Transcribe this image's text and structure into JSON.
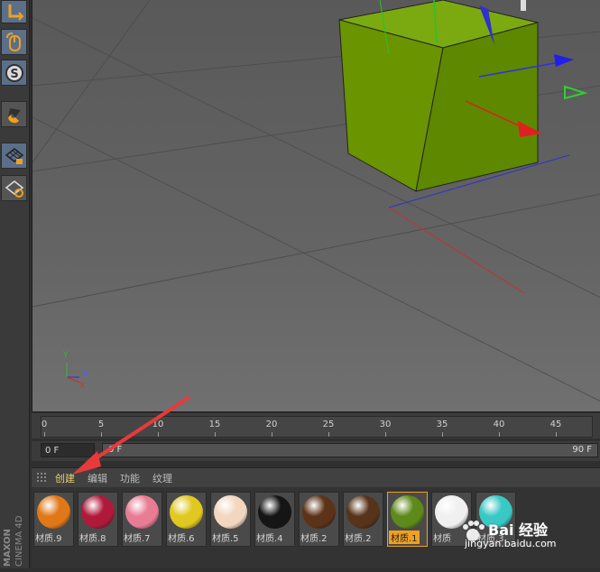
{
  "timeline": {
    "ticks": [
      "0",
      "5",
      "10",
      "15",
      "20",
      "25",
      "30",
      "35",
      "40",
      "45"
    ],
    "frame_start": "0 F",
    "frame_current": "0 F",
    "frame_end": "90 F"
  },
  "material_menu": {
    "items": [
      "创建",
      "编辑",
      "功能",
      "纹理"
    ],
    "active_index": 0
  },
  "materials": [
    {
      "label": "材质.9",
      "color": "#e07818",
      "selected": false
    },
    {
      "label": "材质.8",
      "color": "#b01a3a",
      "selected": false
    },
    {
      "label": "材质.7",
      "color": "#e87c94",
      "selected": false
    },
    {
      "label": "材质.6",
      "color": "#e0c820",
      "selected": false
    },
    {
      "label": "材质.5",
      "color": "#f2d6c0",
      "selected": false
    },
    {
      "label": "材质.4",
      "color": "#151515",
      "selected": false
    },
    {
      "label": "材质.2",
      "color": "#5c3318",
      "selected": false
    },
    {
      "label": "材质.2",
      "color": "#57331a",
      "selected": false
    },
    {
      "label": "材质.1",
      "color": "#5d8a1a",
      "selected": true
    },
    {
      "label": "材质",
      "color": "#f0f0f0",
      "selected": false
    },
    {
      "label": "材质.3",
      "color": "#3ac8c4",
      "selected": false
    }
  ],
  "viewport": {
    "axis_labels": {
      "y": "Y",
      "z": "Z",
      "x": "X"
    },
    "cube_color": "#6a9800"
  },
  "brand": {
    "line1": "MAXON",
    "line2": "CINEMA 4D"
  },
  "watermark": {
    "title": "Bai 经验",
    "url": "jingyan.baidu.com"
  },
  "icons": [
    "corner-icon",
    "mouse-icon",
    "snap-icon",
    "magnet-icon",
    "grid-lock-icon",
    "grid-cycle-icon"
  ]
}
